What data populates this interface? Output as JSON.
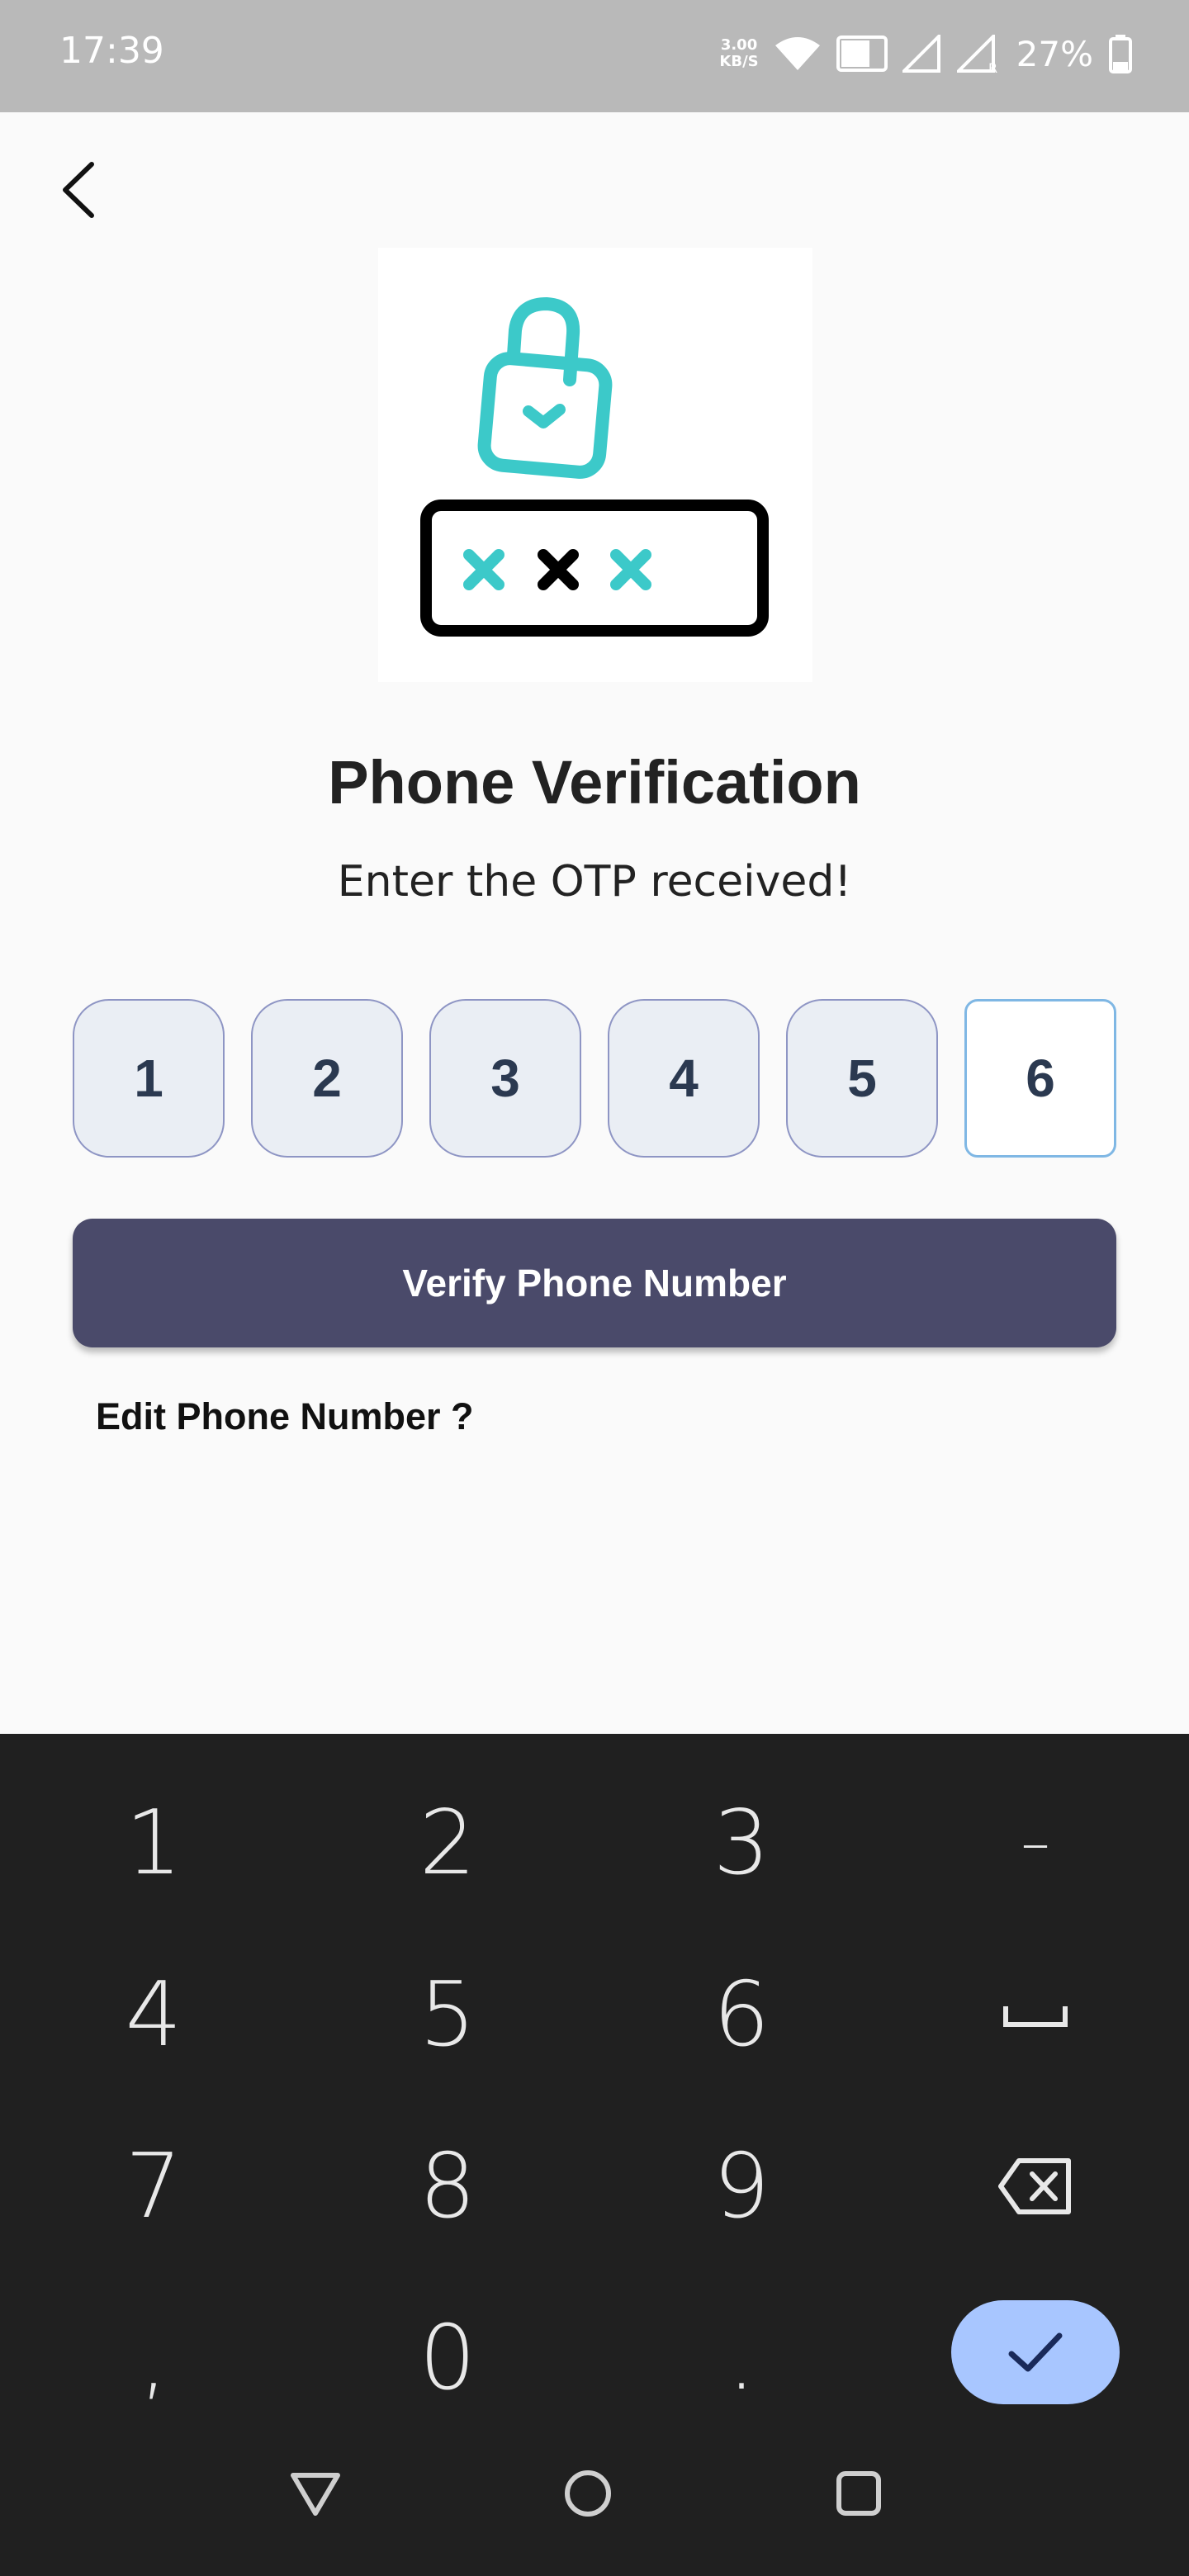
{
  "status_bar": {
    "time": "17:39",
    "speed_value": "3.00",
    "speed_unit": "KB/S",
    "battery": "27%",
    "icons": [
      "wifi-icon",
      "vowifi-icon",
      "signal-icon",
      "signal-roaming-icon",
      "battery-icon"
    ]
  },
  "header": {
    "back_icon": "chevron-left-icon"
  },
  "illustration": {
    "icon": "unlock-password-icon",
    "accent": "#3cc9c9"
  },
  "page": {
    "title": "Phone Verification",
    "subtitle": "Enter the OTP received!"
  },
  "otp": {
    "digits": [
      "1",
      "2",
      "3",
      "4",
      "5",
      "6"
    ]
  },
  "actions": {
    "verify_label": "Verify Phone Number",
    "edit_label": "Edit Phone Number ?"
  },
  "keyboard": {
    "keys": [
      "1",
      "2",
      "3",
      "–",
      "4",
      "5",
      "6",
      "space",
      "7",
      "8",
      "9",
      "backspace",
      ",",
      "0",
      ".",
      "done"
    ],
    "labels": {
      "k1": "1",
      "k2": "2",
      "k3": "3",
      "dash": "–",
      "k4": "4",
      "k5": "5",
      "k6": "6",
      "k7": "7",
      "k8": "8",
      "k9": "9",
      "comma": ",",
      "k0": "0",
      "period": "."
    },
    "done_color": "#a8c6ff"
  },
  "nav_bar": {
    "icons": [
      "back-triangle-icon",
      "home-circle-icon",
      "recents-square-icon"
    ]
  }
}
